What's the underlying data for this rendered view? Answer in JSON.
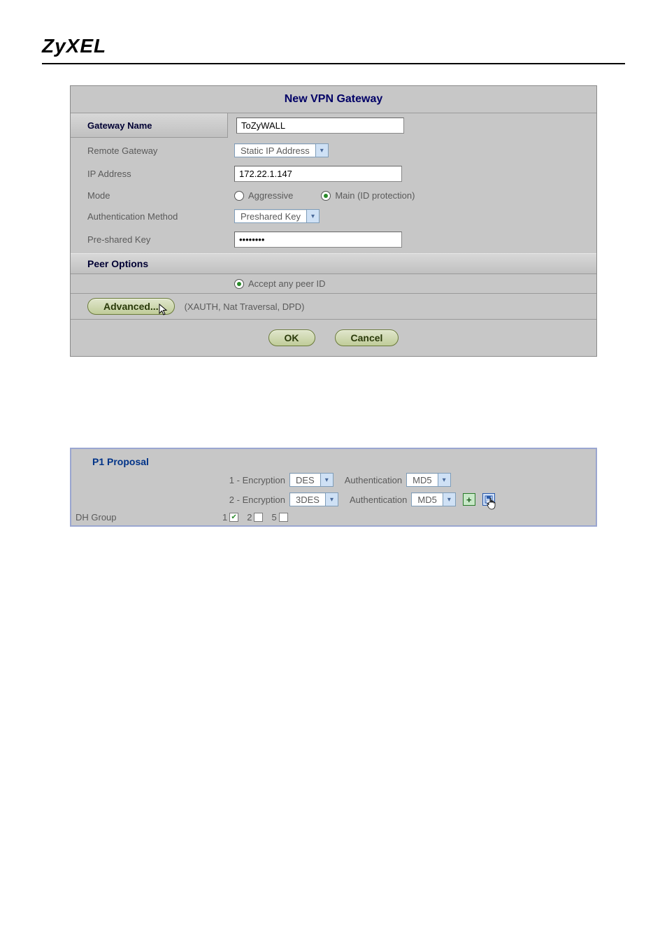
{
  "brand": "ZyXEL",
  "panel1": {
    "title": "New VPN Gateway",
    "gateway_name_label": "Gateway Name",
    "gateway_name_value": "ToZyWALL",
    "remote_gateway_label": "Remote Gateway",
    "remote_gateway_value": "Static IP Address",
    "ip_address_label": "IP Address",
    "ip_address_value": "172.22.1.147",
    "mode_label": "Mode",
    "mode_aggressive": "Aggressive",
    "mode_main": "Main (ID protection)",
    "mode_selected": "main",
    "auth_method_label": "Authentication Method",
    "auth_method_value": "Preshared Key",
    "psk_label": "Pre-shared Key",
    "psk_value": "••••••••",
    "peer_options_header": "Peer Options",
    "accept_any_peer": "Accept any peer ID",
    "advanced_btn": "Advanced...",
    "advanced_note": "(XAUTH, Nat Traversal, DPD)",
    "ok_btn": "OK",
    "cancel_btn": "Cancel"
  },
  "panel2": {
    "title": "P1 Proposal",
    "rows": [
      {
        "idx": "1 - Encryption",
        "enc": "DES",
        "auth_label": "Authentication",
        "auth": "MD5"
      },
      {
        "idx": "2 - Encryption",
        "enc": "3DES",
        "auth_label": "Authentication",
        "auth": "MD5"
      }
    ],
    "dh_group_label": "DH Group",
    "dh_groups": [
      {
        "label": "1",
        "checked": true
      },
      {
        "label": "2",
        "checked": false
      },
      {
        "label": "5",
        "checked": false
      }
    ]
  }
}
